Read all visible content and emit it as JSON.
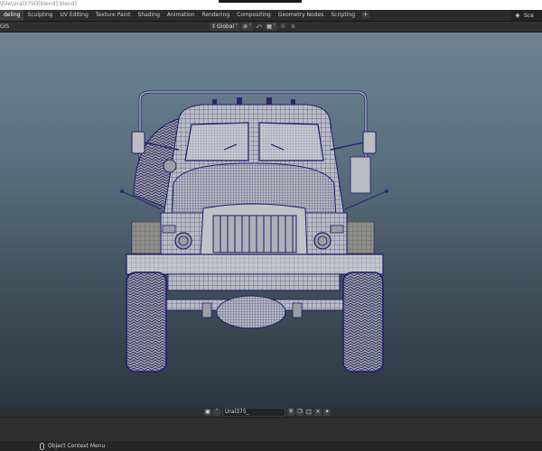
{
  "window": {
    "path": "\\File\\Ural375D[blend].blend]"
  },
  "tabs": [
    {
      "label": "deling"
    },
    {
      "label": "Sculpting"
    },
    {
      "label": "UV Editing"
    },
    {
      "label": "Texture Paint"
    },
    {
      "label": "Shading"
    },
    {
      "label": "Animation"
    },
    {
      "label": "Rendering"
    },
    {
      "label": "Compositing"
    },
    {
      "label": "Geometry Nodes"
    },
    {
      "label": "Scripting"
    }
  ],
  "tab_add": "+",
  "scene": {
    "label": "Sce"
  },
  "header": {
    "mode_label": "GIS",
    "orientation": "Global"
  },
  "footer": {
    "object_name": "Ural375_",
    "ctx_menu": "Object Context Menu"
  },
  "colors": {
    "viewport_top": "#6d8391",
    "viewport_bottom": "#2c3740",
    "wire": "#1e1a6e",
    "mesh": "#b9bcc0"
  },
  "icons": [
    "scene-icon",
    "orientation-icon",
    "pivot-icon",
    "snap-icon",
    "proportional-icon",
    "falloff-icon",
    "datablock-icon",
    "shield-icon",
    "copy-icon",
    "folder-icon",
    "close-icon",
    "pin-icon",
    "mouse-icon"
  ]
}
